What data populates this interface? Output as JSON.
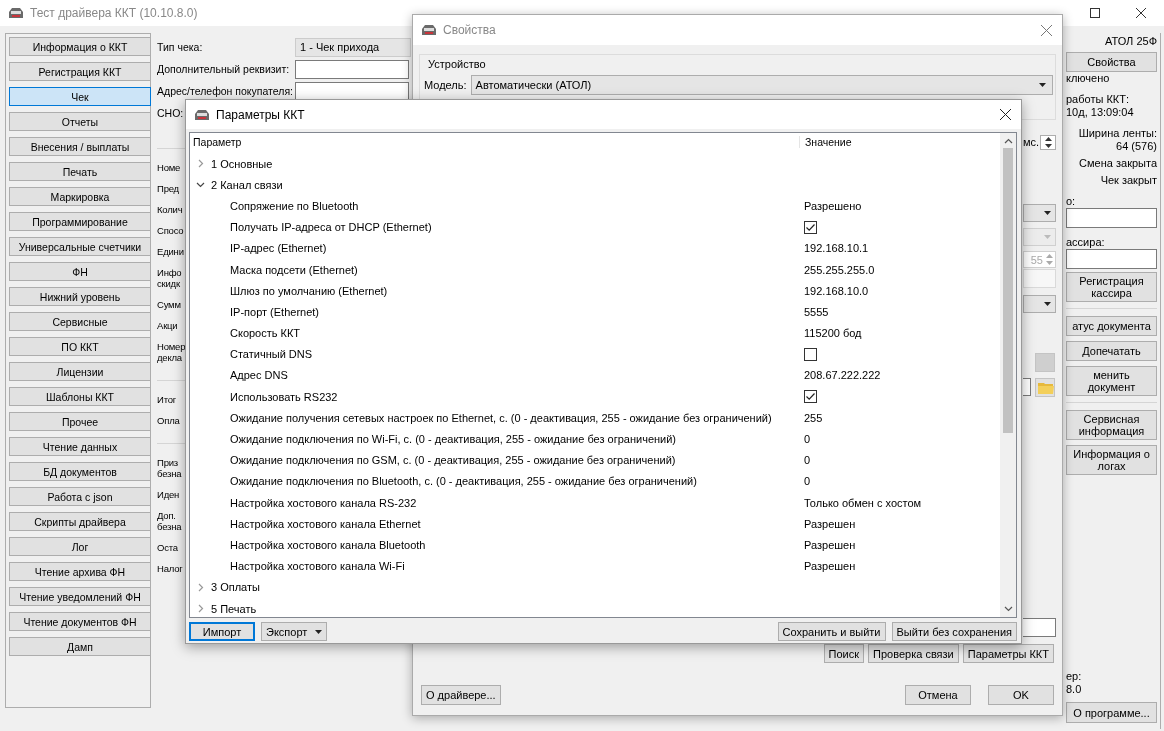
{
  "main_window": {
    "title": "Тест драйвера ККТ (10.10.8.0)",
    "sidebar": [
      {
        "label": "Информация о ККТ",
        "selected": false
      },
      {
        "label": "Регистрация ККТ",
        "selected": false
      },
      {
        "label": "Чек",
        "selected": true
      },
      {
        "label": "Отчеты",
        "selected": false
      },
      {
        "label": "Внесения / выплаты",
        "selected": false
      },
      {
        "label": "Печать",
        "selected": false
      },
      {
        "label": "Маркировка",
        "selected": false
      },
      {
        "label": "Программирование",
        "selected": false
      },
      {
        "label": "Универсальные счетчики",
        "selected": false
      },
      {
        "label": "ФН",
        "selected": false
      },
      {
        "label": "Нижний уровень",
        "selected": false
      },
      {
        "label": "Сервисные",
        "selected": false
      },
      {
        "label": "ПО ККТ",
        "selected": false
      },
      {
        "label": "Лицензии",
        "selected": false
      },
      {
        "label": "Шаблоны ККТ",
        "selected": false
      },
      {
        "label": "Прочее",
        "selected": false
      },
      {
        "label": "Чтение данных",
        "selected": false
      },
      {
        "label": "БД документов",
        "selected": false
      },
      {
        "label": "Работа с json",
        "selected": false
      },
      {
        "label": "Скрипты драйвера",
        "selected": false
      },
      {
        "label": "Лог",
        "selected": false
      },
      {
        "label": "Чтение архива ФН",
        "selected": false
      },
      {
        "label": "Чтение уведомлений ФН",
        "selected": false
      },
      {
        "label": "Чтение документов ФН",
        "selected": false
      },
      {
        "label": "Дамп",
        "selected": false
      }
    ],
    "receipt_form": {
      "fields": [
        {
          "label": "Тип чека:",
          "kind": "combo",
          "value": "1 - Чек прихода"
        },
        {
          "label": "Дополнительный реквизит:",
          "kind": "input"
        },
        {
          "label": "Адрес/телефон покупателя:",
          "kind": "input"
        },
        {
          "label": "СНО:",
          "kind": "label"
        }
      ],
      "label_groups": [
        [
          "Номе",
          "Пред",
          "Колич",
          "Спосо",
          "Едини",
          "Инфо скидк",
          "Сумм",
          "Акци",
          "Номер декла"
        ],
        [
          "Итог",
          "Опла"
        ],
        [
          "Приз безна",
          "Иден",
          "Доп. безна",
          "Оста",
          "Налог"
        ]
      ]
    },
    "device_panel": {
      "model": "АТОЛ 25Ф",
      "properties_button": "Свойства",
      "connection": "ключено",
      "uptime_label": "работы ККТ:",
      "uptime": "10д, 13:09:04",
      "tape_width_label": "Ширина ленты:",
      "tape_width": "64 (576)",
      "shift_status": "Смена закрыта",
      "receipt_status": "Чек закрыт",
      "field_1_label": "о:",
      "field_2_label": "ассира:",
      "button_groups": [
        [
          "Регистрация кассира"
        ],
        [
          "атус документа",
          "Допечатать",
          "менить документ"
        ],
        [
          "Сервисная информация",
          "Информация о логах"
        ]
      ],
      "version_label": "ер:",
      "version": "8.0",
      "about_button": "О программе..."
    }
  },
  "properties_dialog": {
    "title": "Свойства",
    "group": "Устройство",
    "model_label": "Модель:",
    "model_value": "Автоматически (АТОЛ)",
    "interval_unit": "мс.",
    "spinner_value": "55",
    "buttons": [
      "Поиск",
      "Проверка связи",
      "Параметры ККТ"
    ],
    "about_button": "О драйвере...",
    "cancel_button": "Отмена",
    "ok_button": "OK"
  },
  "params_dialog": {
    "title": "Параметры ККТ",
    "columns": [
      "Параметр",
      "Значение"
    ],
    "rows": [
      {
        "label": "1 Основные",
        "expanded": false
      },
      {
        "label": "2 Канал связи",
        "expanded": true,
        "children": [
          {
            "label": "Сопряжение по Bluetooth",
            "kind": "text",
            "value": "Разрешено"
          },
          {
            "label": "Получать IP-адреса от DHCP (Ethernet)",
            "kind": "checkbox",
            "checked": true
          },
          {
            "label": "IP-адрес (Ethernet)",
            "kind": "text",
            "value": "192.168.10.1"
          },
          {
            "label": "Маска подсети (Ethernet)",
            "kind": "text",
            "value": "255.255.255.0"
          },
          {
            "label": "Шлюз по умолчанию (Ethernet)",
            "kind": "text",
            "value": "192.168.10.0"
          },
          {
            "label": "IP-порт (Ethernet)",
            "kind": "text",
            "value": "5555"
          },
          {
            "label": "Скорость ККТ",
            "kind": "text",
            "value": "115200 бод"
          },
          {
            "label": "Статичный DNS",
            "kind": "checkbox",
            "checked": false
          },
          {
            "label": "Адрес DNS",
            "kind": "text",
            "value": "208.67.222.222"
          },
          {
            "label": "Использовать RS232",
            "kind": "checkbox",
            "checked": true
          },
          {
            "label": "Ожидание получения сетевых настроек по Ethernet, с. (0 - деактивация, 255 - ожидание без ограничений)",
            "kind": "text",
            "value": "255"
          },
          {
            "label": "Ожидание подключения по Wi-Fi, с. (0 - деактивация, 255 - ожидание без ограничений)",
            "kind": "text",
            "value": "0"
          },
          {
            "label": "Ожидание подключения по GSM, с. (0 - деактивация, 255 - ожидание без ограничений)",
            "kind": "text",
            "value": "0"
          },
          {
            "label": "Ожидание подключения по Bluetooth, с. (0 - деактивация, 255 - ожидание без ограничений)",
            "kind": "text",
            "value": "0"
          },
          {
            "label": "Настройка хостового канала RS-232",
            "kind": "text",
            "value": "Только обмен с хостом"
          },
          {
            "label": "Настройка хостового канала Ethernet",
            "kind": "text",
            "value": "Разрешен"
          },
          {
            "label": "Настройка хостового канала Bluetooth",
            "kind": "text",
            "value": "Разрешен"
          },
          {
            "label": "Настройка хостового канала Wi-Fi",
            "kind": "text",
            "value": "Разрешен"
          }
        ]
      },
      {
        "label": "3 Оплаты",
        "expanded": false
      },
      {
        "label": "5 Печать",
        "expanded": false
      }
    ],
    "import_button": {
      "label": "Импорт",
      "focused": true
    },
    "export_button": "Экспорт",
    "save_button": "Сохранить и выйти",
    "exit_button": "Выйти без сохранения"
  }
}
